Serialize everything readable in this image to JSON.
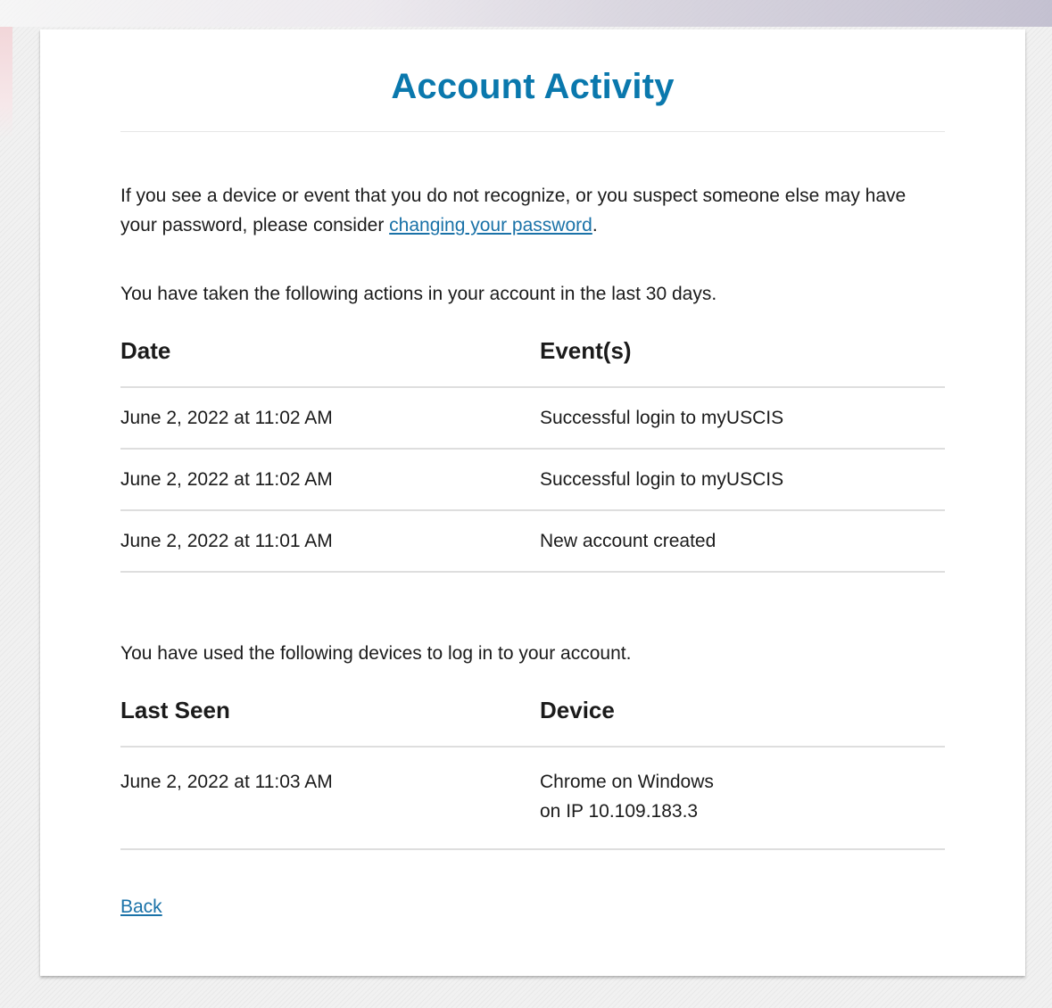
{
  "header": {
    "title": "Account Activity"
  },
  "intro": {
    "text_before": "If you see a device or event that you do not recognize, or you suspect someone else may have your password, please consider ",
    "link_text": "changing your password",
    "text_after": "."
  },
  "actions": {
    "description": "You have taken the following actions in your account in the last 30 days.",
    "columns": [
      "Date",
      "Event(s)"
    ],
    "rows": [
      {
        "date": "June 2, 2022 at 11:02 AM",
        "event": "Successful login to myUSCIS"
      },
      {
        "date": "June 2, 2022 at 11:02 AM",
        "event": "Successful login to myUSCIS"
      },
      {
        "date": "June 2, 2022 at 11:01 AM",
        "event": "New account created"
      }
    ]
  },
  "devices": {
    "description": "You have used the following devices to log in to your account.",
    "columns": [
      "Last Seen",
      "Device"
    ],
    "rows": [
      {
        "last_seen": "June 2, 2022 at 11:03 AM",
        "device": "Chrome on Windows",
        "ip": "on IP 10.109.183.3"
      }
    ]
  },
  "footer": {
    "back_label": "Back"
  },
  "colors": {
    "title": "#0a78ad",
    "link": "#1a72a8",
    "text": "#1b1b1b",
    "divider": "#dedede"
  }
}
